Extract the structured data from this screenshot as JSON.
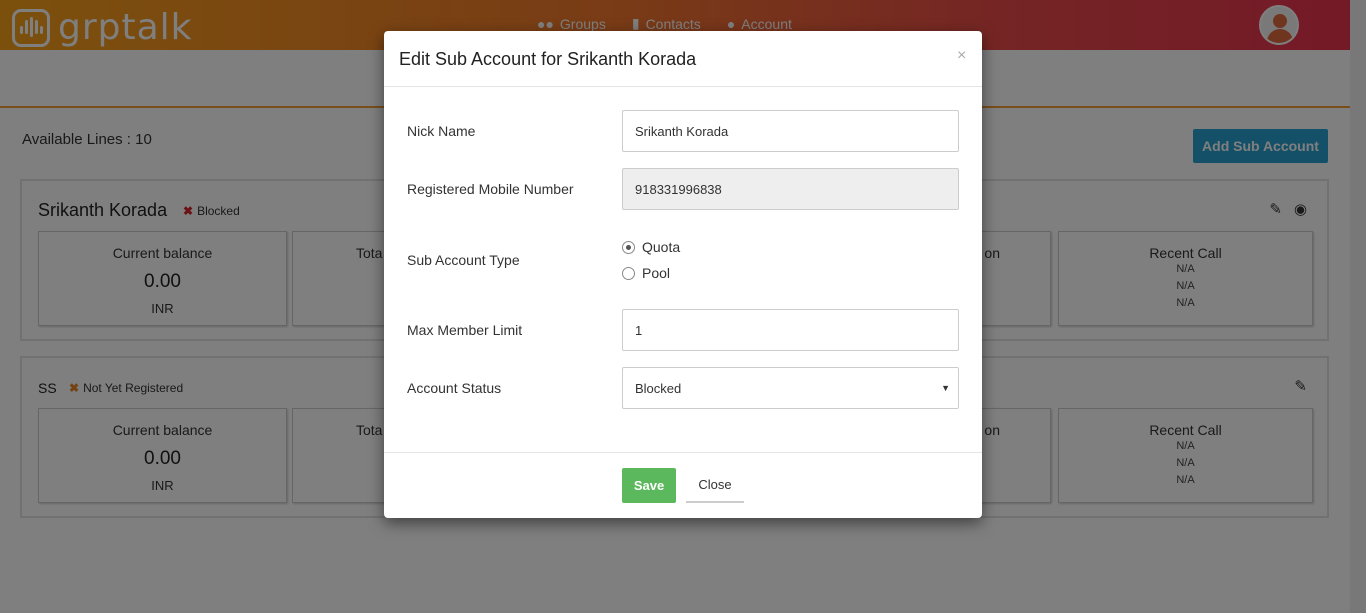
{
  "app": {
    "logo_text": "grptalk"
  },
  "nav": {
    "groups": "Groups",
    "contacts": "Contacts",
    "account": "Account"
  },
  "page": {
    "available_lines": "Available Lines : 10",
    "add_button": "Add Sub Account"
  },
  "accounts": [
    {
      "name": "Srikanth Korada",
      "status": "Blocked",
      "status_color": "#d9232d",
      "cards": [
        {
          "title": "Current balance",
          "value": "0.00",
          "unit": "INR"
        },
        {
          "title": "Tota"
        },
        {
          "title": "on"
        },
        {
          "title": "Recent Call",
          "lines": [
            "N/A",
            "N/A",
            "N/A"
          ]
        }
      ]
    },
    {
      "name": "SS",
      "status": "Not Yet Registered",
      "status_color": "#e8872a",
      "cards": [
        {
          "title": "Current balance",
          "value": "0.00",
          "unit": "INR"
        },
        {
          "title": "Tota"
        },
        {
          "title": "on"
        },
        {
          "title": "Recent Call",
          "lines": [
            "N/A",
            "N/A",
            "N/A"
          ]
        }
      ]
    }
  ],
  "modal": {
    "title": "Edit Sub Account for Srikanth Korada",
    "close_symbol": "×",
    "fields": {
      "nick_name_label": "Nick Name",
      "nick_name_value": "Srikanth Korada",
      "mobile_label": "Registered Mobile Number",
      "mobile_value": "918331996838",
      "type_label": "Sub Account Type",
      "type_options": [
        "Quota",
        "Pool"
      ],
      "type_selected": "Quota",
      "max_member_label": "Max Member Limit",
      "max_member_value": "1",
      "status_label": "Account Status",
      "status_value": "Blocked"
    },
    "save_label": "Save",
    "close_label": "Close"
  },
  "colors": {
    "save": "#5cb85c",
    "add": "#29a3d1",
    "accent": "#f39c35"
  }
}
